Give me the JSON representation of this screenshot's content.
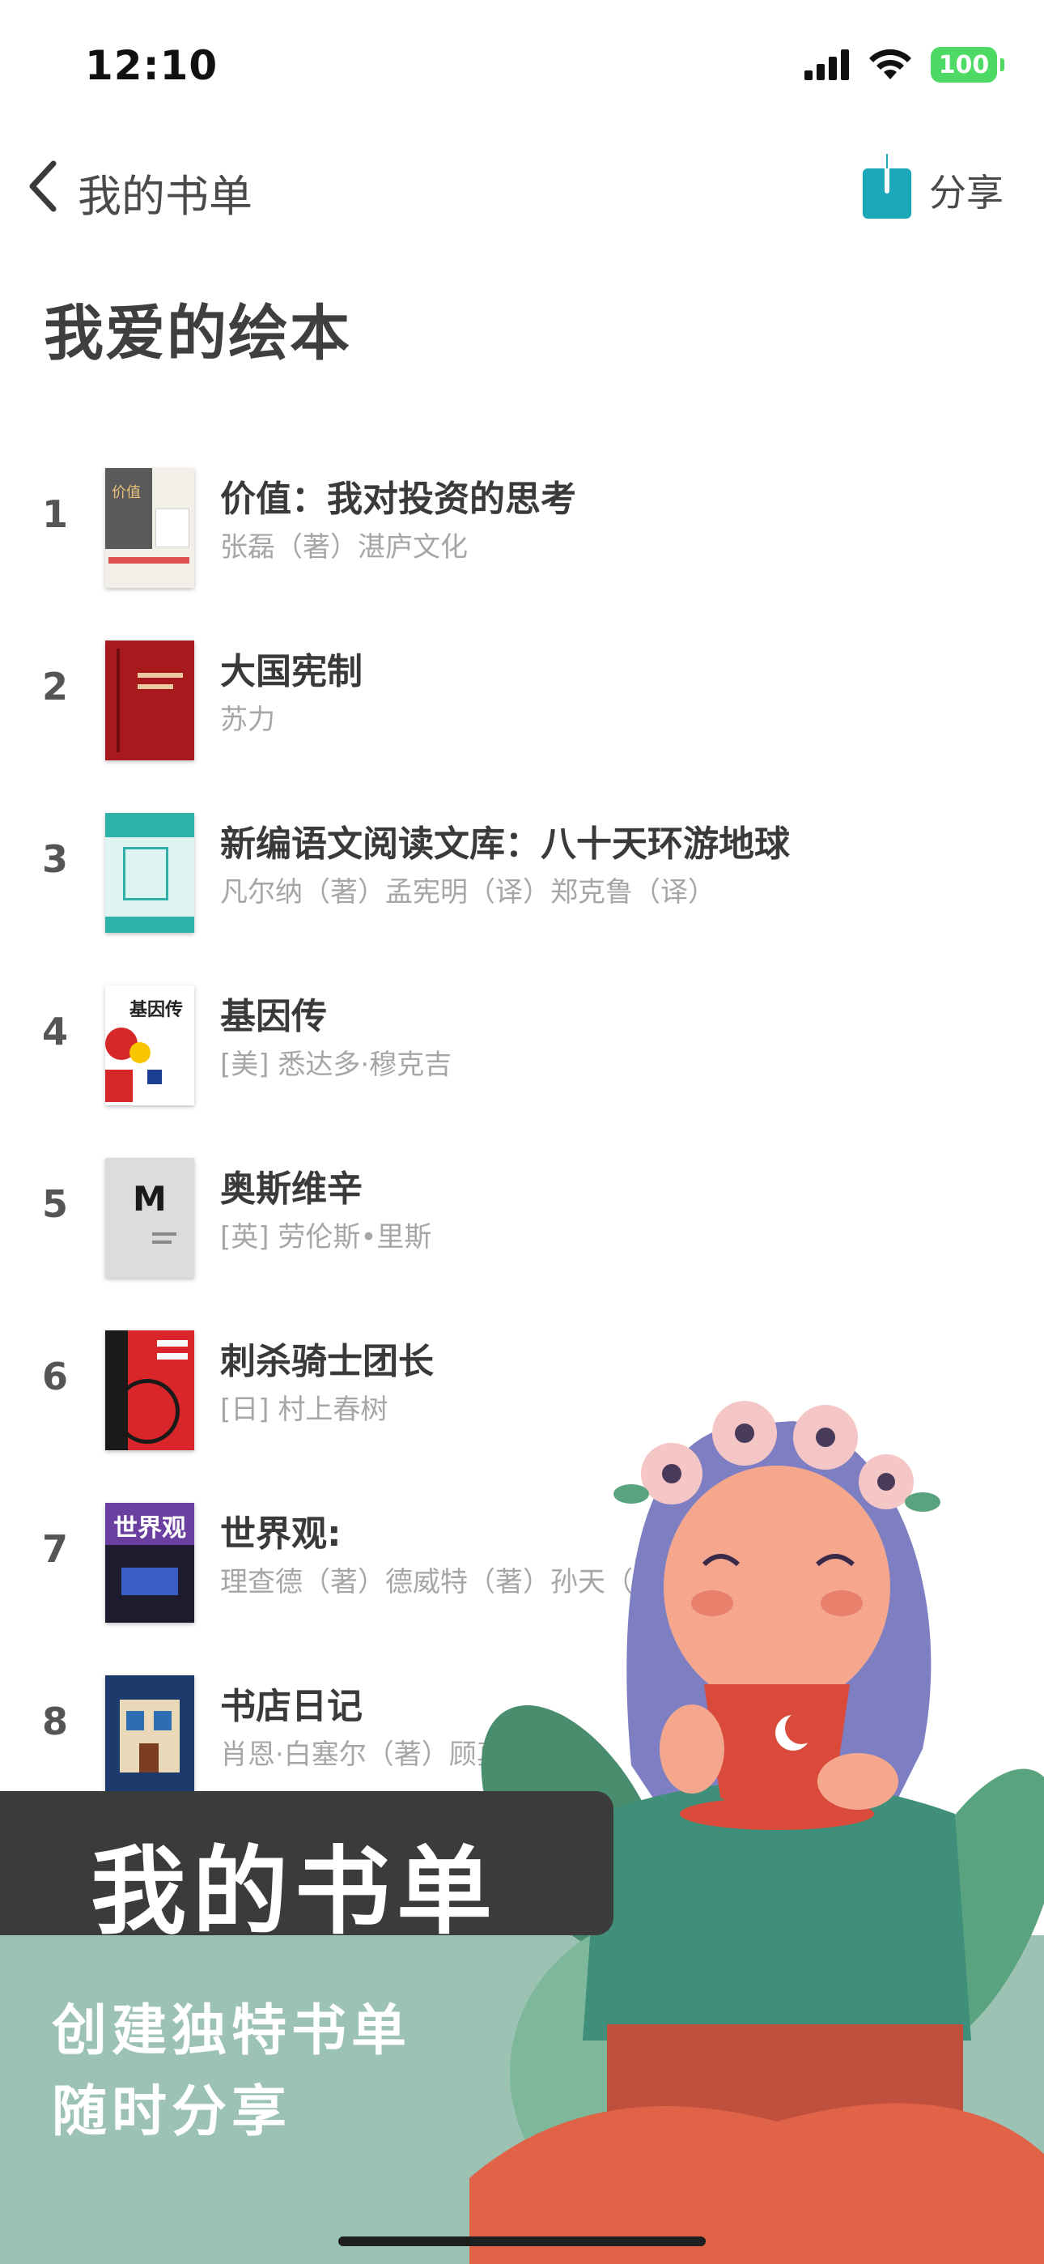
{
  "status": {
    "time": "12:10",
    "battery": "100"
  },
  "nav": {
    "back_label": "我的书单",
    "share_label": "分享"
  },
  "page_title": "我爱的绘本",
  "books": [
    {
      "rank": "1",
      "title": "价值：我对投资的思考",
      "author": "张磊（著）湛庐文化"
    },
    {
      "rank": "2",
      "title": "大国宪制",
      "author": "苏力"
    },
    {
      "rank": "3",
      "title": "新编语文阅读文库：八十天环游地球",
      "author": "凡尔纳（著）孟宪明（译）郑克鲁（译）"
    },
    {
      "rank": "4",
      "title": "基因传",
      "author": "[美] 悉达多·穆克吉"
    },
    {
      "rank": "5",
      "title": "奥斯维辛",
      "author": "[英] 劳伦斯•里斯"
    },
    {
      "rank": "6",
      "title": "刺杀骑士团长",
      "author": "[日] 村上春树"
    },
    {
      "rank": "7",
      "title": "世界观:",
      "author": "理查德（著）德威特（著）孙天（著"
    },
    {
      "rank": "8",
      "title": "书店日记",
      "author": "肖恩·白塞尔（著）顾真"
    }
  ],
  "covers": {
    "c1": "价值",
    "c4": "基因传",
    "c5": "M",
    "c7": "世界观"
  },
  "promo": {
    "banner": "我的书单",
    "line1": "创建独特书单",
    "line2": "随时分享"
  },
  "colors": {
    "accent": "#1ba8b8",
    "promo_bg": "#9cc2b4",
    "banner_bg": "#3b3b3b"
  }
}
